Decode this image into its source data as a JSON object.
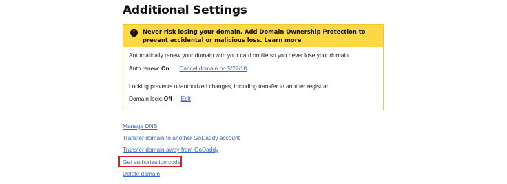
{
  "page": {
    "title": "Additional Settings"
  },
  "banner": {
    "icon": "exclamation-icon",
    "message": "Never risk losing your domain. Add Domain Ownership Protection to prevent accidental or malicious loss.",
    "link": "Learn more"
  },
  "renewal": {
    "description": "Automatically renew your domain with your card on file so you never lose your domain.",
    "label": "Auto renew:",
    "value": "On",
    "action": "Cancel domain on 5/27/18"
  },
  "lock": {
    "description": "Locking prevents unauthorized changes, including transfer to another registrar.",
    "label": "Domain lock:",
    "value": "Off",
    "action": "Edit"
  },
  "links": [
    "Manage DNS",
    "Transfer domain to another GoDaddy account",
    "Transfer domain away from GoDaddy",
    "Get authorization code",
    "Delete domain"
  ],
  "highlight_color": "#d21f1f"
}
